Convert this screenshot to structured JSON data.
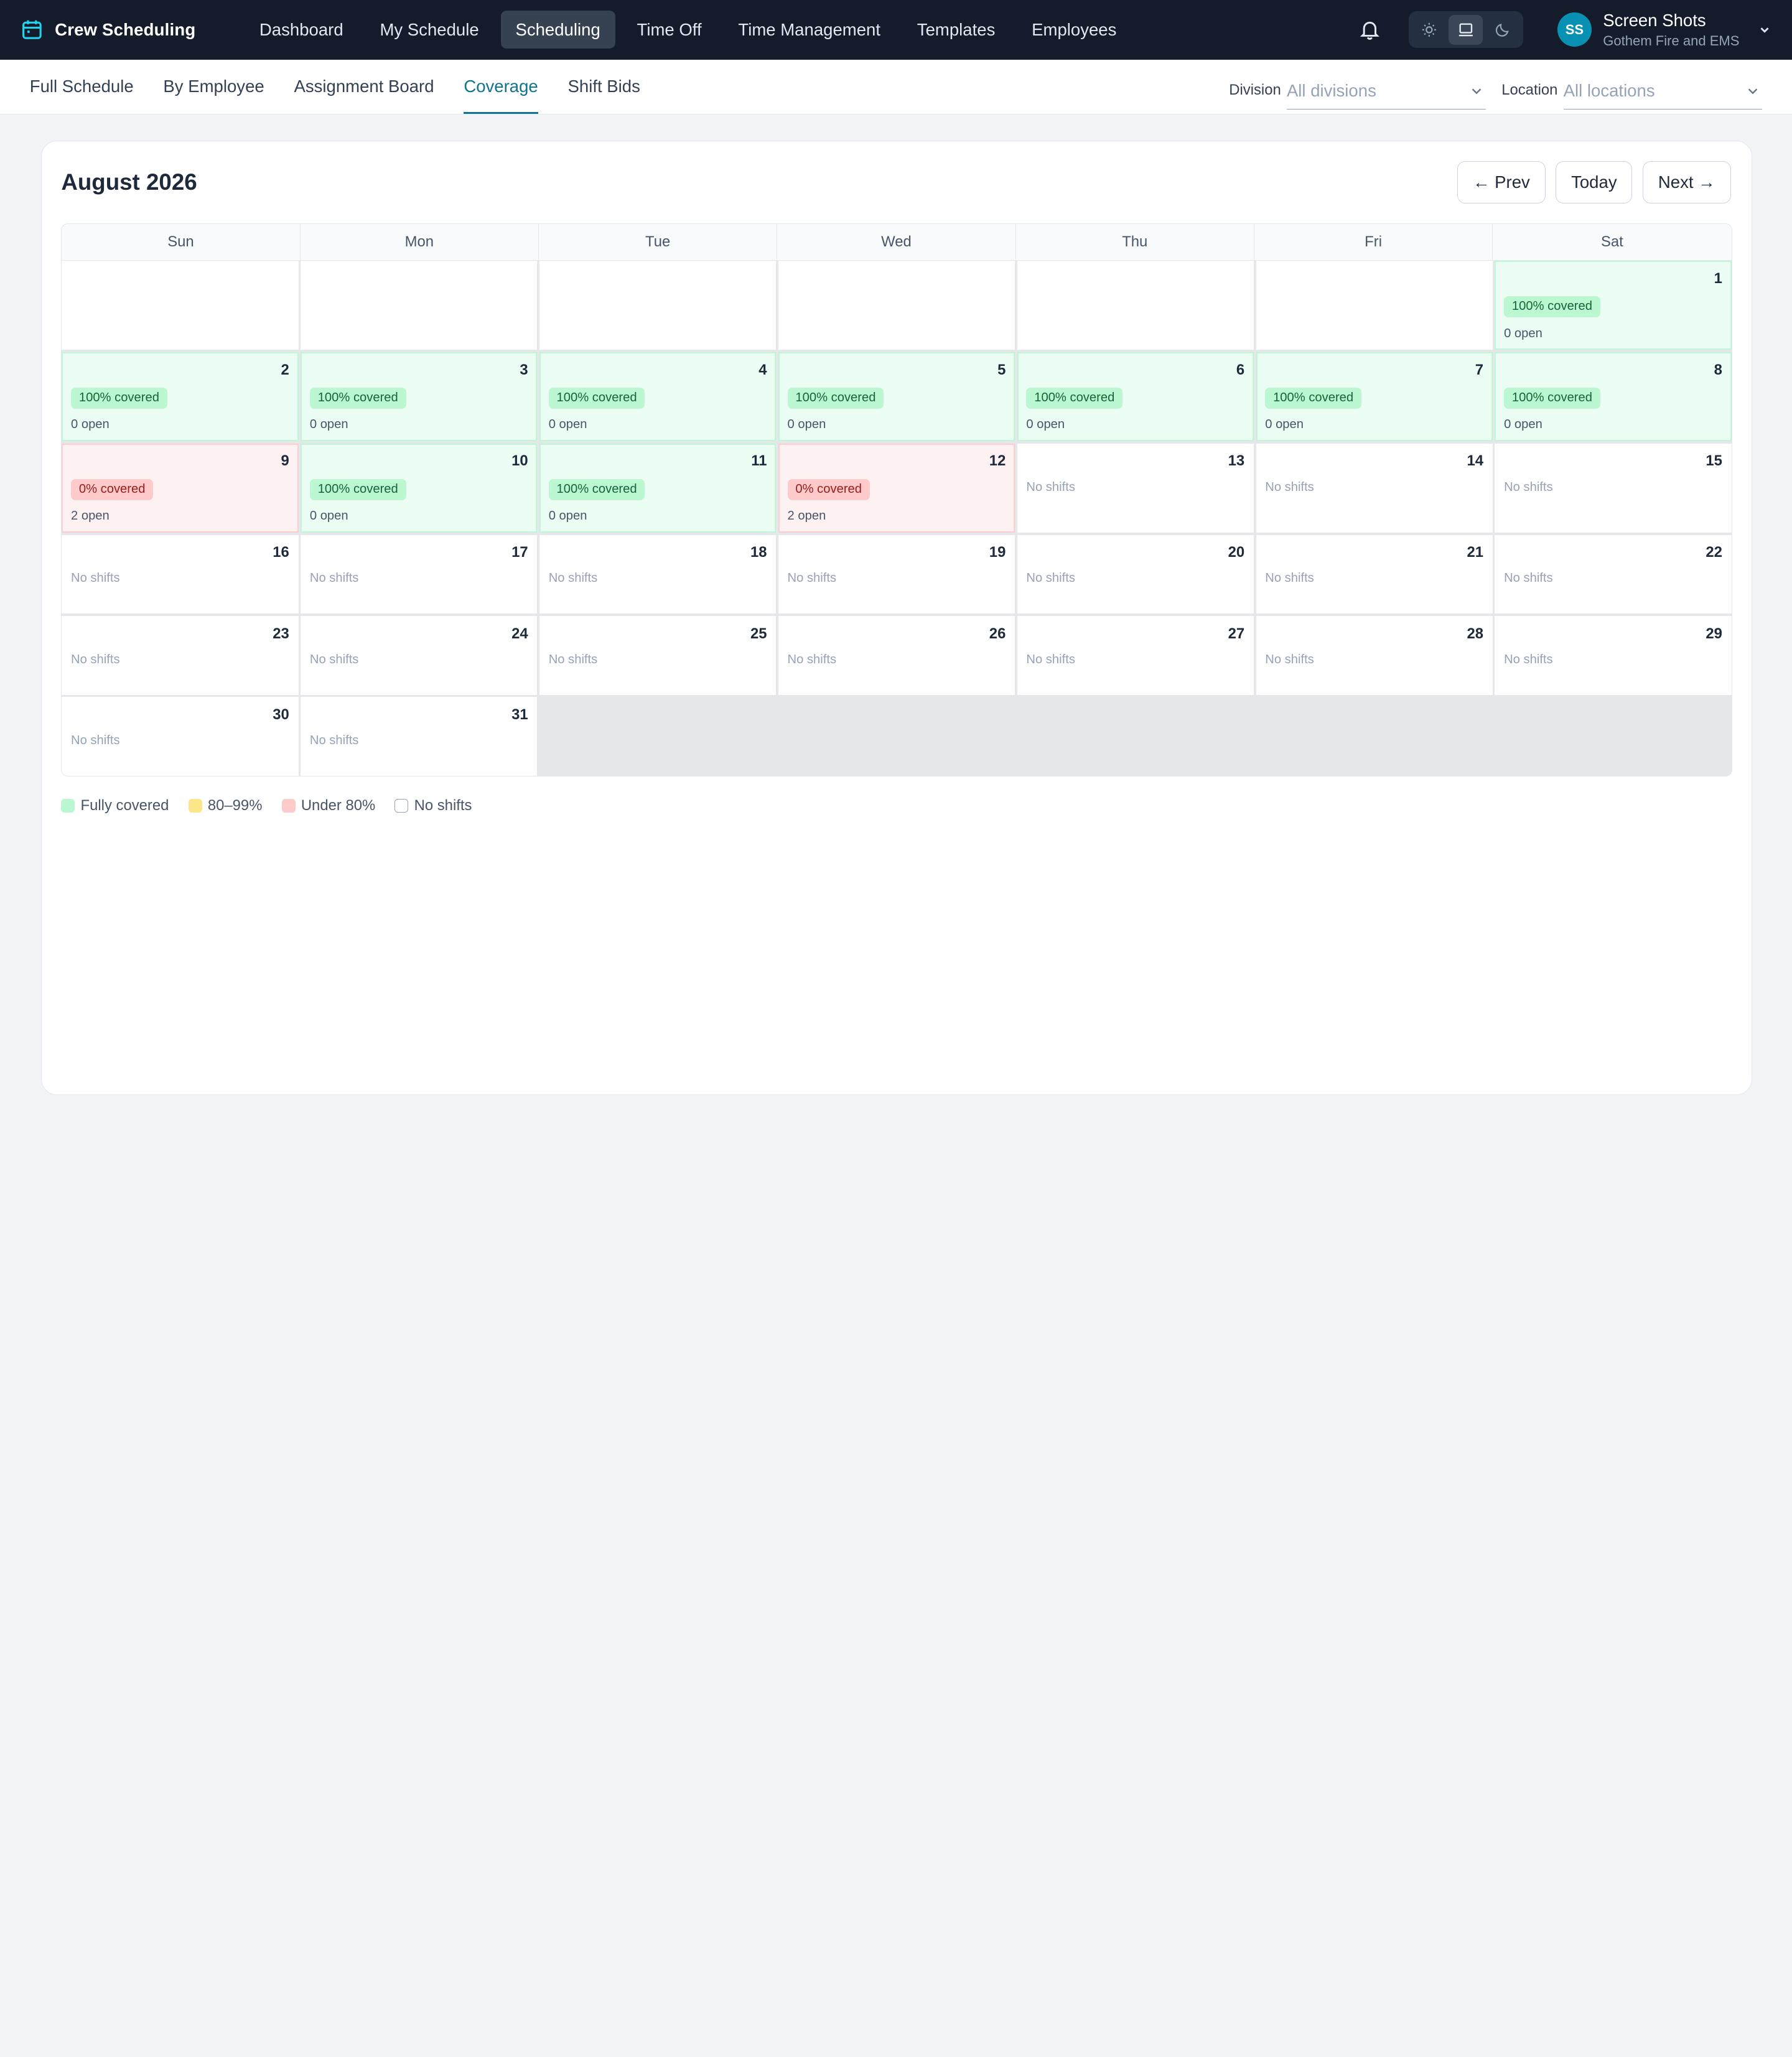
{
  "app": {
    "name": "Crew Scheduling",
    "nav": [
      "Dashboard",
      "My Schedule",
      "Scheduling",
      "Time Off",
      "Time Management",
      "Templates",
      "Employees"
    ],
    "active_nav": "Scheduling",
    "user": {
      "initials": "SS",
      "name": "Screen Shots",
      "org": "Gothem Fire and EMS"
    }
  },
  "subnav": {
    "tabs": [
      "Full Schedule",
      "By Employee",
      "Assignment Board",
      "Coverage",
      "Shift Bids"
    ],
    "active": "Coverage",
    "division_label": "Division",
    "division_value": "All divisions",
    "location_label": "Location",
    "location_value": "All locations"
  },
  "calendar": {
    "title": "August 2026",
    "prev_label": "← Prev",
    "today_label": "Today",
    "next_label": "Next →",
    "weekdays": [
      "Sun",
      "Mon",
      "Tue",
      "Wed",
      "Thu",
      "Fri",
      "Sat"
    ],
    "leading_blanks": 6,
    "days": [
      {
        "day": "1",
        "status": "full",
        "badge": "100% covered",
        "open": "0 open"
      },
      {
        "day": "2",
        "status": "full",
        "badge": "100% covered",
        "open": "0 open"
      },
      {
        "day": "3",
        "status": "full",
        "badge": "100% covered",
        "open": "0 open"
      },
      {
        "day": "4",
        "status": "full",
        "badge": "100% covered",
        "open": "0 open"
      },
      {
        "day": "5",
        "status": "full",
        "badge": "100% covered",
        "open": "0 open"
      },
      {
        "day": "6",
        "status": "full",
        "badge": "100% covered",
        "open": "0 open"
      },
      {
        "day": "7",
        "status": "full",
        "badge": "100% covered",
        "open": "0 open"
      },
      {
        "day": "8",
        "status": "full",
        "badge": "100% covered",
        "open": "0 open"
      },
      {
        "day": "9",
        "status": "under",
        "badge": "0% covered",
        "open": "2 open"
      },
      {
        "day": "10",
        "status": "full",
        "badge": "100% covered",
        "open": "0 open"
      },
      {
        "day": "11",
        "status": "full",
        "badge": "100% covered",
        "open": "0 open"
      },
      {
        "day": "12",
        "status": "under",
        "badge": "0% covered",
        "open": "2 open"
      },
      {
        "day": "13",
        "status": "none",
        "note": "No shifts"
      },
      {
        "day": "14",
        "status": "none",
        "note": "No shifts"
      },
      {
        "day": "15",
        "status": "none",
        "note": "No shifts"
      },
      {
        "day": "16",
        "status": "none",
        "note": "No shifts"
      },
      {
        "day": "17",
        "status": "none",
        "note": "No shifts"
      },
      {
        "day": "18",
        "status": "none",
        "note": "No shifts"
      },
      {
        "day": "19",
        "status": "none",
        "note": "No shifts"
      },
      {
        "day": "20",
        "status": "none",
        "note": "No shifts"
      },
      {
        "day": "21",
        "status": "none",
        "note": "No shifts"
      },
      {
        "day": "22",
        "status": "none",
        "note": "No shifts"
      },
      {
        "day": "23",
        "status": "none",
        "note": "No shifts"
      },
      {
        "day": "24",
        "status": "none",
        "note": "No shifts"
      },
      {
        "day": "25",
        "status": "none",
        "note": "No shifts"
      },
      {
        "day": "26",
        "status": "none",
        "note": "No shifts"
      },
      {
        "day": "27",
        "status": "none",
        "note": "No shifts"
      },
      {
        "day": "28",
        "status": "none",
        "note": "No shifts"
      },
      {
        "day": "29",
        "status": "none",
        "note": "No shifts"
      },
      {
        "day": "30",
        "status": "none",
        "note": "No shifts"
      },
      {
        "day": "31",
        "status": "none",
        "note": "No shifts"
      }
    ]
  },
  "legend": [
    {
      "label": "Fully covered",
      "color": "#bbf7d0",
      "border": "#bbf7d0"
    },
    {
      "label": "80–99%",
      "color": "#fde68a",
      "border": "#fde68a"
    },
    {
      "label": "Under 80%",
      "color": "#fecaca",
      "border": "#fecaca"
    },
    {
      "label": "No shifts",
      "color": "#ffffff",
      "border": "#94a3b8"
    }
  ],
  "colors": {
    "accent": "#0e7490",
    "topbar": "#141c2b",
    "avatar": "#0891b2"
  }
}
